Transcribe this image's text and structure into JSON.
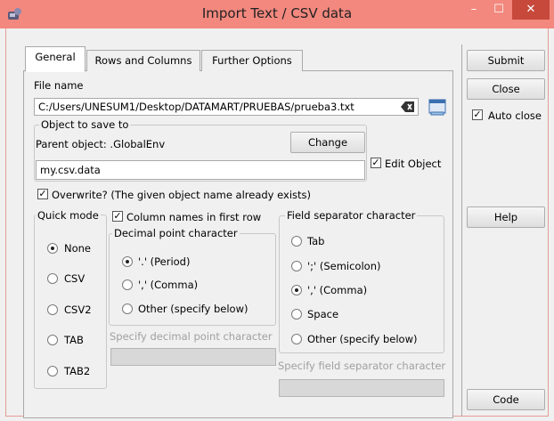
{
  "window": {
    "title": "Import Text / CSV data",
    "controls": {
      "minimize": "–",
      "maximize": "☐",
      "close": "✕"
    }
  },
  "tabs": [
    {
      "label": "General",
      "active": true
    },
    {
      "label": "Rows and Columns",
      "active": false
    },
    {
      "label": "Further Options",
      "active": false
    }
  ],
  "general": {
    "file_name_label": "File name",
    "file_path": "C:/Users/UNESUM1/Desktop/DATAMART/PRUEBAS/prueba3.txt",
    "object_group_label": "Object to save to",
    "parent_object_text": "Parent object: .GlobalEnv",
    "change_button": "Change",
    "object_name": "my.csv.data",
    "edit_object_label": "Edit Object",
    "edit_object_checked": true,
    "overwrite_label": "Overwrite? (The given object name already exists)",
    "overwrite_checked": true,
    "quick_mode": {
      "label": "Quick mode",
      "options": [
        "None",
        "CSV",
        "CSV2",
        "TAB",
        "TAB2"
      ],
      "selected": "None"
    },
    "column_names_label": "Column names in first row",
    "column_names_checked": true,
    "decimal": {
      "label": "Decimal point character",
      "options": [
        "'.' (Period)",
        "',' (Comma)",
        "Other (specify below)"
      ],
      "selected": "'.' (Period)",
      "specify_label": "Specify decimal point character"
    },
    "field_sep": {
      "label": "Field separator character",
      "options": [
        "Tab",
        "';' (Semicolon)",
        "',' (Comma)",
        "Space",
        "Other (specify below)"
      ],
      "selected": "',' (Comma)",
      "specify_label": "Specify field separator character"
    }
  },
  "sidebar": {
    "submit": "Submit",
    "close": "Close",
    "auto_close_label": "Auto close",
    "auto_close_checked": true,
    "help": "Help",
    "code": "Code"
  },
  "colors": {
    "titlebar": "#f2887e",
    "close_button": "#c7493c",
    "window_bg": "#f0f0f0"
  },
  "icons": {
    "app": "r-app-icon",
    "clear": "clear-backspace-icon",
    "browse": "browse-file-icon"
  }
}
